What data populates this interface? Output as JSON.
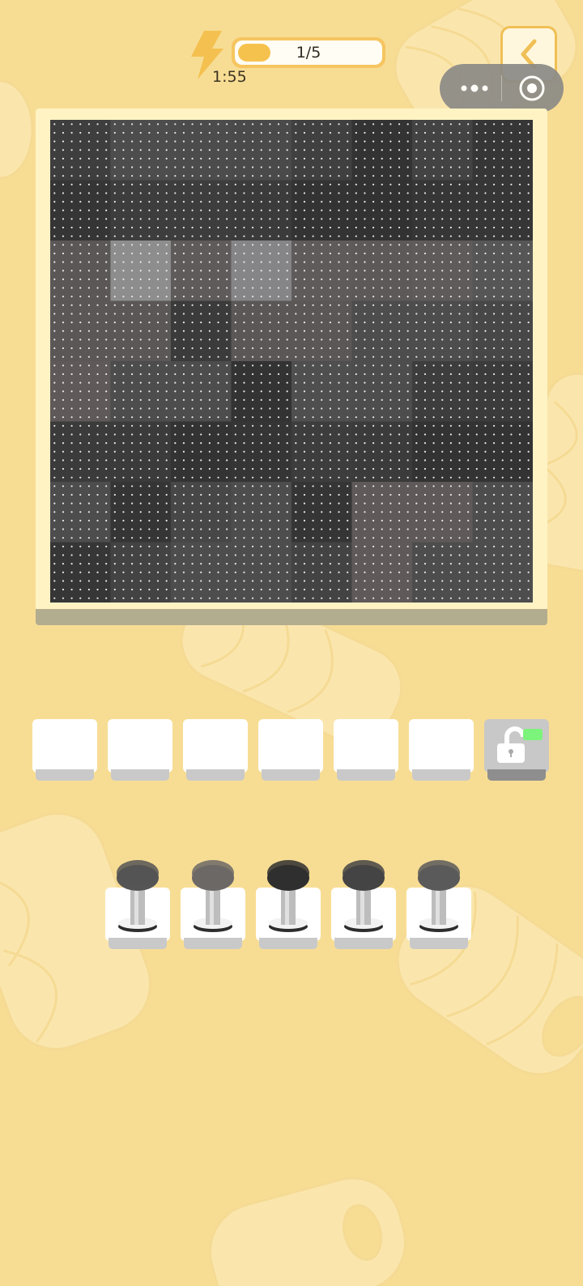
{
  "hud": {
    "energy_icon": "lightning-bolt-icon",
    "timer": "1:55",
    "progress_text": "1/5",
    "progress_value": 0.2
  },
  "mini_program": {
    "more_icon": "more-dots-icon",
    "target_icon": "target-circle-icon"
  },
  "back_icon": "chevron-left-icon",
  "colors": {
    "background": "#f7dd94",
    "board": "#fff3c4",
    "bolt": "#f4c04f"
  },
  "board": {
    "rows": 8,
    "cols": 8,
    "cells": [
      [
        "#3e3e3e",
        "#4d4d4d",
        "#4c4c4c",
        "#4a4a4a",
        "#404040",
        "#333333",
        "#434343",
        "#363636"
      ],
      [
        "#353535",
        "#3d3d3d",
        "#3d3d3d",
        "#3b3b3b",
        "#333333",
        "#323232",
        "#363636",
        "#363636"
      ],
      [
        "#5b5757",
        "#8d8d8d",
        "#5f5b5b",
        "#858587",
        "#5f5b5b",
        "#5d5959",
        "#5f5b5b",
        "#565656"
      ],
      [
        "#5b5757",
        "#5b5757",
        "#3b3b3b",
        "#5b5757",
        "#5b5757",
        "#4d4d4d",
        "#4d4d4d",
        "#474747"
      ],
      [
        "#5f5959",
        "#4d4d4d",
        "#4d4d4d",
        "#333333",
        "#4f4f4f",
        "#4d4d4d",
        "#3d3d3d",
        "#3b3b3b"
      ],
      [
        "#3b3b3b",
        "#3b3b3b",
        "#333333",
        "#353535",
        "#3d3d3d",
        "#3b3b3b",
        "#333333",
        "#333333"
      ],
      [
        "#4d4d4d",
        "#353535",
        "#474747",
        "#4d4d4d",
        "#353535",
        "#5f5959",
        "#5f5959",
        "#4d4d4d"
      ],
      [
        "#363636",
        "#434343",
        "#4d4d4d",
        "#4d4d4d",
        "#434343",
        "#5f5959",
        "#4d4d4d",
        "#4d4d4d"
      ]
    ]
  },
  "slots": {
    "count": 7,
    "locked_index": 6,
    "lock_icon": "unlock-padlock-icon"
  },
  "spools": [
    {
      "color": "#555555"
    },
    {
      "color": "#6c6866"
    },
    {
      "color": "#2f2f2f"
    },
    {
      "color": "#444444"
    },
    {
      "color": "#5a5a5a"
    }
  ]
}
